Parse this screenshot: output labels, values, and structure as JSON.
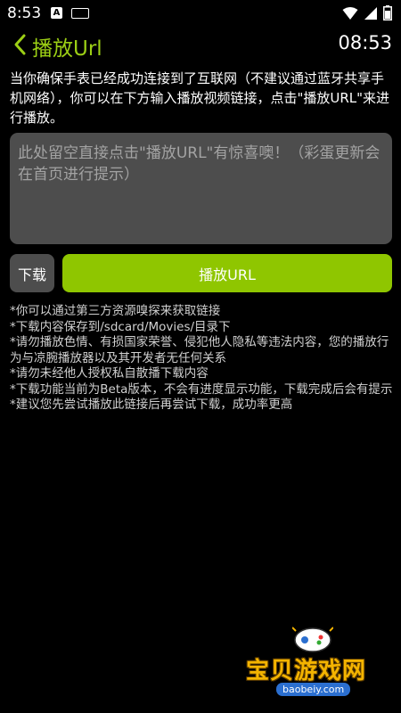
{
  "status_bar": {
    "time": "8:53",
    "a_badge": "A",
    "icons": [
      "keyboard-icon",
      "wifi-icon",
      "signal-icon",
      "battery-icon"
    ]
  },
  "app_bar": {
    "title": "播放Url",
    "clock": "08:53"
  },
  "intro_text": "当你确保手表已经成功连接到了互联网（不建议通过蓝牙共享手机网络），你可以在下方输入播放视频链接，点击\"播放URL\"来进行播放。",
  "url_input": {
    "placeholder": "此处留空直接点击\"播放URL\"有惊喜噢！（彩蛋更新会在首页进行提示）",
    "value": ""
  },
  "buttons": {
    "download": "下载",
    "play": "播放URL"
  },
  "notes": [
    "*你可以通过第三方资源嗅探来获取链接",
    "*下载内容保存到/sdcard/Movies/目录下",
    "*请勿播放色情、有损国家荣誉、侵犯他人隐私等违法内容，您的播放行为与凉腕播放器以及其开发者无任何关系",
    "*请勿未经他人授权私自散播下载内容",
    "*下载功能当前为Beta版本，不会有进度显示功能，下载完成后会有提示",
    "*建议您先尝试播放此链接后再尝试下载，成功率更高"
  ],
  "watermark": {
    "name": "宝贝游戏网",
    "url": "baobeiy.com"
  },
  "colors": {
    "accent": "#8fc600",
    "title_green": "#9ccf15",
    "background": "#000000",
    "input_bg": "#4d4d4d"
  }
}
